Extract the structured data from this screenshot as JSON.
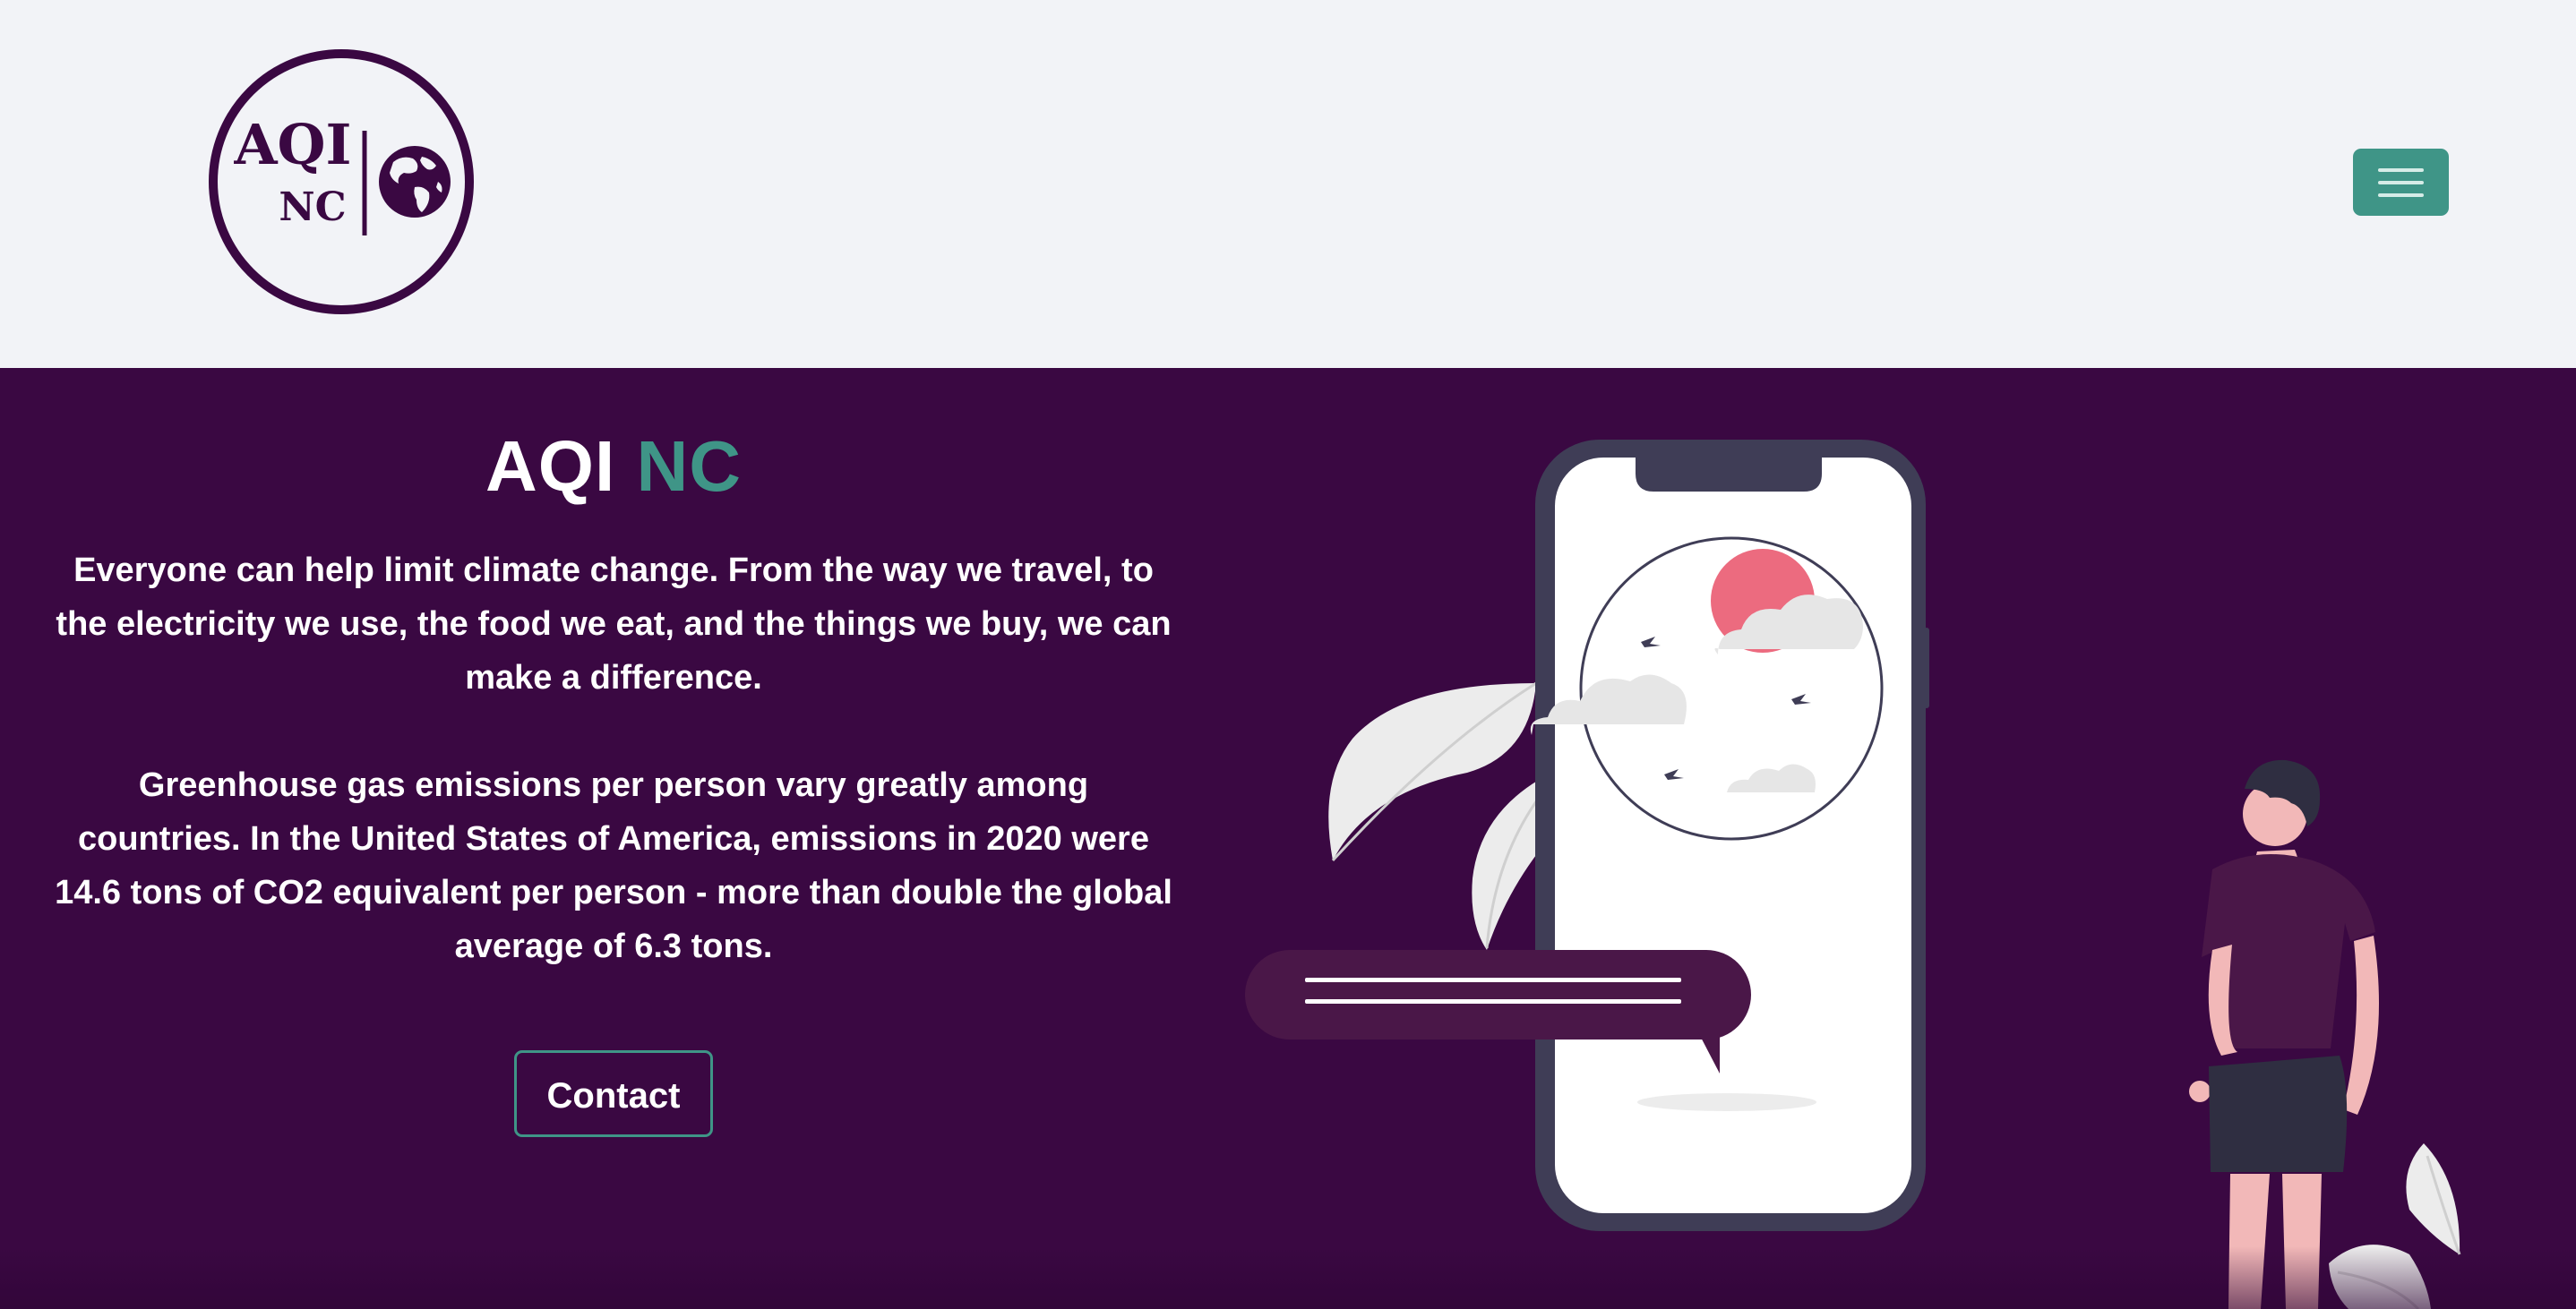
{
  "header": {
    "logo": {
      "line1": "AQI",
      "line2": "NC",
      "icon": "globe-icon"
    },
    "menu_icon": "hamburger-menu-icon"
  },
  "hero": {
    "title_main": "AQI",
    "title_accent": "NC",
    "paragraph1": "Everyone can help limit climate change. From the way we travel, to the electricity we use, the food we eat, and the things we buy, we can make a difference.",
    "paragraph2": "Greenhouse gas emissions per person vary greatly among countries. In the United States of America, emissions in 2020 were 14.6 tons of CO2 equivalent per person - more than double the global average of 6.3 tons.",
    "contact_label": "Contact"
  },
  "colors": {
    "brand_purple": "#3a0842",
    "accent_teal": "#3f9587",
    "header_bg": "#f2f3f7",
    "sun_pink": "#ec6b7f"
  }
}
